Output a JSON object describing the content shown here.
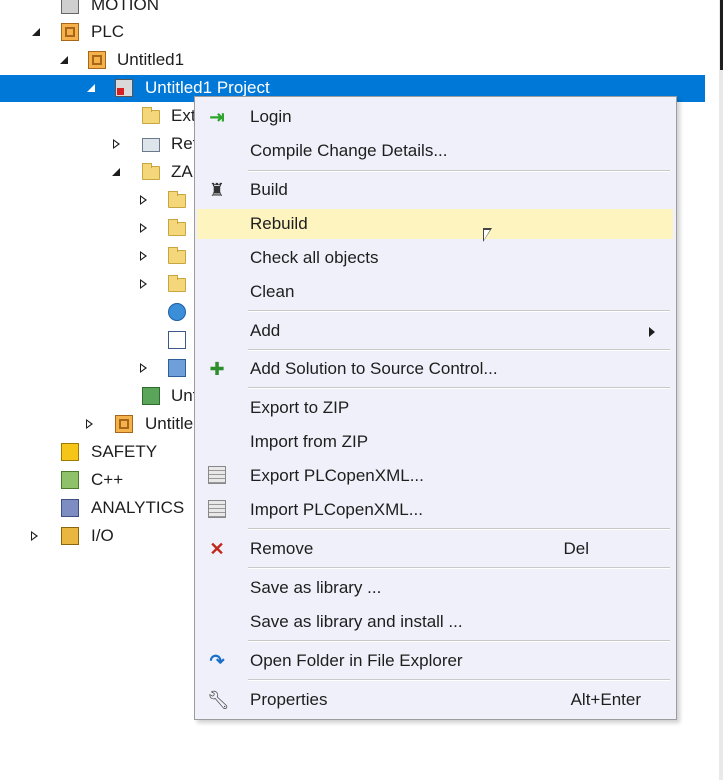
{
  "tree": {
    "items": [
      {
        "label": "MOTION",
        "icon": "motion-icon"
      },
      {
        "label": "PLC",
        "icon": "plc-icon"
      },
      {
        "label": "Untitled1",
        "icon": "plc-project-icon"
      },
      {
        "label": "Untitled1 Project",
        "icon": "project-icon"
      },
      {
        "label": "Ext",
        "icon": "folder-icon"
      },
      {
        "label": "Ref",
        "icon": "references-icon"
      },
      {
        "label": "ZA",
        "icon": "folder-open-icon"
      },
      {
        "label": "Unt",
        "icon": "task-icon"
      },
      {
        "label": "Untitle",
        "icon": "plc-instance-icon"
      },
      {
        "label": "SAFETY",
        "icon": "safety-icon"
      },
      {
        "label": "C++",
        "icon": "cpp-icon"
      },
      {
        "label": "ANALYTICS",
        "icon": "analytics-icon"
      },
      {
        "label": "I/O",
        "icon": "io-icon"
      }
    ]
  },
  "menu": {
    "items": [
      {
        "label": "Login",
        "icon": "login-icon",
        "shortcut": ""
      },
      {
        "label": "Compile Change Details...",
        "icon": "",
        "shortcut": ""
      },
      {
        "label": "Build",
        "icon": "build-icon",
        "shortcut": ""
      },
      {
        "label": "Rebuild",
        "icon": "",
        "shortcut": "",
        "highlighted": true
      },
      {
        "label": "Check all objects",
        "icon": "",
        "shortcut": ""
      },
      {
        "label": "Clean",
        "icon": "",
        "shortcut": ""
      },
      {
        "label": "Add",
        "icon": "",
        "shortcut": "",
        "submenu": true
      },
      {
        "label": "Add Solution to Source Control...",
        "icon": "source-control-icon",
        "shortcut": ""
      },
      {
        "label": "Export to ZIP",
        "icon": "",
        "shortcut": ""
      },
      {
        "label": "Import from ZIP",
        "icon": "",
        "shortcut": ""
      },
      {
        "label": "Export PLCopenXML...",
        "icon": "xml-export-icon",
        "shortcut": ""
      },
      {
        "label": "Import PLCopenXML...",
        "icon": "xml-import-icon",
        "shortcut": ""
      },
      {
        "label": "Remove",
        "icon": "remove-icon",
        "shortcut": "Del"
      },
      {
        "label": "Save as library ...",
        "icon": "",
        "shortcut": ""
      },
      {
        "label": "Save as library and install ...",
        "icon": "",
        "shortcut": ""
      },
      {
        "label": "Open Folder in File Explorer",
        "icon": "open-folder-icon",
        "shortcut": ""
      },
      {
        "label": "Properties",
        "icon": "wrench-icon",
        "shortcut": "Alt+Enter"
      }
    ]
  },
  "colors": {
    "selection": "#0078d7",
    "menu_background": "#f0f0fa",
    "menu_highlight": "#fdf4bf"
  }
}
